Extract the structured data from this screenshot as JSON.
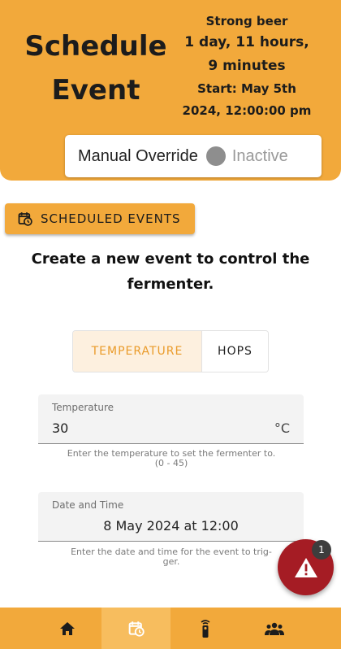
{
  "header": {
    "title_line1": "Schedule",
    "title_line2": "Event",
    "beer_name": "Strong beer",
    "duration_line1": "1 day, 11 hours,",
    "duration_line2": "9 minutes",
    "start_line1": "Start: May 5th",
    "start_line2": "2024, 12:00:00 pm"
  },
  "override": {
    "label": "Manual Override",
    "state": "Inactive"
  },
  "scheduled_events_button": "SCHEDULED EVENTS",
  "headline": "Create a new event to control the fermenter.",
  "toggle": {
    "options": [
      "TEMPERATURE",
      "HOPS"
    ],
    "selected": "TEMPERATURE"
  },
  "temperature_field": {
    "label": "Temperature",
    "value": "30",
    "suffix": "°C",
    "hint_line1": "Enter the temperature to set the fermenter to.",
    "hint_line2": "(0 - 45)"
  },
  "datetime_field": {
    "label": "Date and Time",
    "value": "8 May 2024 at 12:00",
    "hint_line1": "Enter the date and time for the event to trig-",
    "hint_line2": "ger."
  },
  "alert": {
    "count": "1"
  },
  "nav": {
    "items": [
      "home-icon",
      "schedule-icon",
      "remote-icon",
      "people-icon"
    ],
    "active": "schedule-icon"
  },
  "colors": {
    "primary": "#f2a93b",
    "active_nav": "#f7bd5e",
    "alert": "#a51c24",
    "toggle_selected_text": "#ea9b2a"
  }
}
